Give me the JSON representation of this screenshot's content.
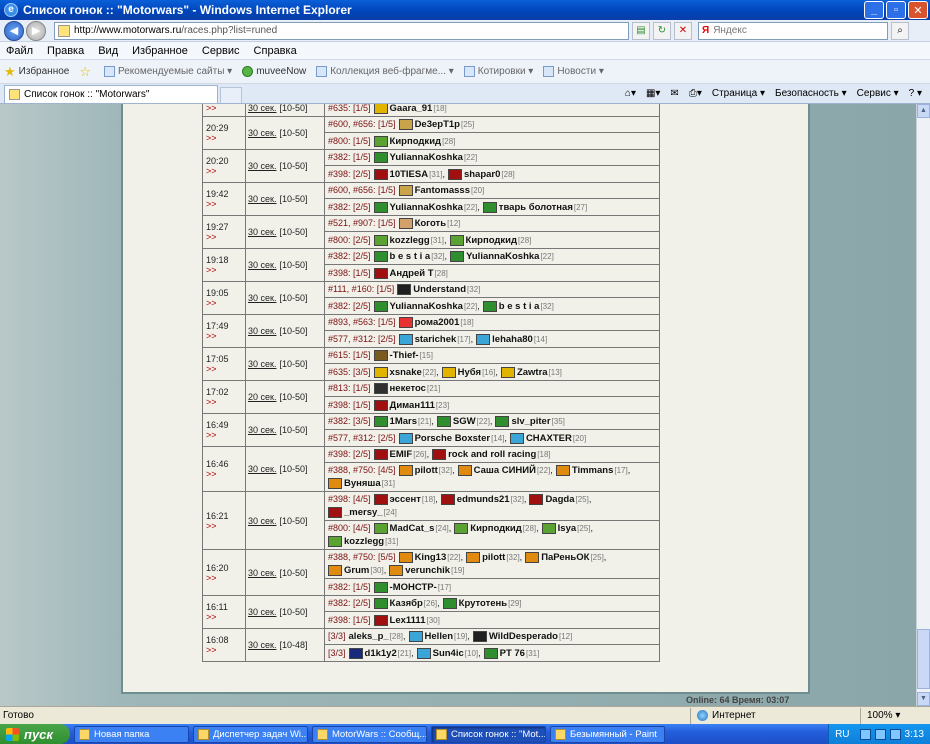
{
  "window": {
    "title": "Список гонок :: \"Motorwars\" - Windows Internet Explorer",
    "minimize": "_",
    "maximize": "▫",
    "close": "✕"
  },
  "address": {
    "url_host": "http://www.motorwars.ru",
    "url_path": "/races.php?list=runed",
    "search_label": "Я",
    "search_placeholder": "Яндекс"
  },
  "menu": [
    "Файл",
    "Правка",
    "Вид",
    "Избранное",
    "Сервис",
    "Справка"
  ],
  "favorites": {
    "label": "Избранное",
    "items": [
      "Рекомендуемые сайты ▾",
      "muveeNow",
      "Коллекция веб-фрагме... ▾",
      "Котировки ▾",
      "Новости ▾"
    ]
  },
  "tab": {
    "title": "Список гонок :: \"Motorwars\""
  },
  "tabtools": [
    "Страница ▾",
    "Безопасность ▾",
    "Сервис ▾",
    "? ▾"
  ],
  "races": [
    {
      "time": "",
      "duration": "30 сек.",
      "range": "[10-50]",
      "entries": [
        {
          "prefix": "#635: [1/5]",
          "racers": [
            {
              "name": "Gaara_91",
              "lvl": "[18]",
              "clan": "yb"
            }
          ]
        }
      ]
    },
    {
      "time": "20:29",
      "duration": "30 сек.",
      "range": "[10-50]",
      "entries": [
        {
          "prefix": "#600, #656: [1/5]",
          "racers": [
            {
              "name": "De3epT1p",
              "lvl": "[25]",
              "clan": "gold"
            }
          ]
        },
        {
          "prefix": "#800: [1/5]",
          "racers": [
            {
              "name": "Кирподкид",
              "lvl": "[28]",
              "clan": "leaf"
            }
          ]
        }
      ]
    },
    {
      "time": "20:20",
      "duration": "30 сек.",
      "range": "[10-50]",
      "entries": [
        {
          "prefix": "#382: [1/5]",
          "racers": [
            {
              "name": "YuliannaKoshka",
              "lvl": "[22]",
              "clan": "green"
            }
          ]
        },
        {
          "prefix": "#398: [2/5]",
          "racers": [
            {
              "name": "10TIESA",
              "lvl": "[31]",
              "clan": "red"
            },
            {
              "name": "shapar0",
              "lvl": "[28]",
              "clan": "red"
            }
          ]
        }
      ]
    },
    {
      "time": "19:42",
      "duration": "30 сек.",
      "range": "[10-50]",
      "entries": [
        {
          "prefix": "#600, #656: [1/5]",
          "racers": [
            {
              "name": "Fantomasss",
              "lvl": "[20]",
              "clan": "gold"
            }
          ]
        },
        {
          "prefix": "#382: [2/5]",
          "racers": [
            {
              "name": "YuliannaKoshka",
              "lvl": "[22]",
              "clan": "green"
            },
            {
              "name": "тварь болотная",
              "lvl": "[27]",
              "clan": "green"
            }
          ]
        }
      ]
    },
    {
      "time": "19:27",
      "duration": "30 сек.",
      "range": "[10-50]",
      "entries": [
        {
          "prefix": "#521, #907: [1/5]",
          "racers": [
            {
              "name": "Коготь",
              "lvl": "[12]",
              "clan": "face"
            }
          ]
        },
        {
          "prefix": "#800: [2/5]",
          "racers": [
            {
              "name": "kozzlegg",
              "lvl": "[31]",
              "clan": "leaf"
            },
            {
              "name": "Кирподкид",
              "lvl": "[28]",
              "clan": "leaf"
            }
          ]
        }
      ]
    },
    {
      "time": "19:18",
      "duration": "30 сек.",
      "range": "[10-50]",
      "entries": [
        {
          "prefix": "#382: [2/5]",
          "racers": [
            {
              "name": "b e s t i a",
              "lvl": "[32]",
              "clan": "green"
            },
            {
              "name": "YuliannaKoshka",
              "lvl": "[22]",
              "clan": "green"
            }
          ]
        },
        {
          "prefix": "#398: [1/5]",
          "racers": [
            {
              "name": "Андрей Т",
              "lvl": "[28]",
              "clan": "red"
            }
          ]
        }
      ]
    },
    {
      "time": "19:05",
      "duration": "30 сек.",
      "range": "[10-50]",
      "entries": [
        {
          "prefix": "#111, #160: [1/5]",
          "racers": [
            {
              "name": "Understand",
              "lvl": "[32]",
              "clan": "dark"
            }
          ]
        },
        {
          "prefix": "#382: [2/5]",
          "racers": [
            {
              "name": "YuliannaKoshka",
              "lvl": "[22]",
              "clan": "green"
            },
            {
              "name": "b e s t i a",
              "lvl": "[32]",
              "clan": "green"
            }
          ]
        }
      ]
    },
    {
      "time": "17:49",
      "duration": "30 сек.",
      "range": "[10-50]",
      "entries": [
        {
          "prefix": "#893, #563: [1/5]",
          "racers": [
            {
              "name": "рома2001",
              "lvl": "[18]",
              "clan": "bird"
            }
          ]
        },
        {
          "prefix": "#577, #312: [2/5]",
          "racers": [
            {
              "name": "starichek",
              "lvl": "[17]",
              "clan": "blue"
            },
            {
              "name": "lehaha80",
              "lvl": "[14]",
              "clan": "blue"
            }
          ]
        }
      ]
    },
    {
      "time": "17:05",
      "duration": "30 сек.",
      "range": "[10-50]",
      "entries": [
        {
          "prefix": "#615: [1/5]",
          "racers": [
            {
              "name": "-Thief-",
              "lvl": "[15]",
              "clan": "shield"
            }
          ]
        },
        {
          "prefix": "#635: [3/5]",
          "racers": [
            {
              "name": "xsnake",
              "lvl": "[22]",
              "clan": "yb"
            },
            {
              "name": "Нубя",
              "lvl": "[16]",
              "clan": "yb"
            },
            {
              "name": "Zawtra",
              "lvl": "[13]",
              "clan": "yb"
            }
          ]
        }
      ]
    },
    {
      "time": "17:02",
      "duration": "20 сек.",
      "range": "[10-50]",
      "entries": [
        {
          "prefix": "#813: [1/5]",
          "racers": [
            {
              "name": "некетос",
              "lvl": "[21]",
              "clan": "slash"
            }
          ]
        },
        {
          "prefix": "#398: [1/5]",
          "racers": [
            {
              "name": "Диман111",
              "lvl": "[23]",
              "clan": "red"
            }
          ]
        }
      ]
    },
    {
      "time": "16:49",
      "duration": "30 сек.",
      "range": "[10-50]",
      "entries": [
        {
          "prefix": "#382: [3/5]",
          "racers": [
            {
              "name": "1Mars",
              "lvl": "[21]",
              "clan": "green"
            },
            {
              "name": "SGW",
              "lvl": "[22]",
              "clan": "green"
            },
            {
              "name": "slv_piter",
              "lvl": "[35]",
              "clan": "green"
            }
          ]
        },
        {
          "prefix": "#577, #312: [2/5]",
          "racers": [
            {
              "name": "Porsche Boxster",
              "lvl": "[14]",
              "clan": "blue"
            },
            {
              "name": "CHAXTER",
              "lvl": "[20]",
              "clan": "blue"
            }
          ]
        }
      ]
    },
    {
      "time": "16:46",
      "duration": "30 сек.",
      "range": "[10-50]",
      "entries": [
        {
          "prefix": "#398: [2/5]",
          "racers": [
            {
              "name": "EMIF",
              "lvl": "[26]",
              "clan": "red"
            },
            {
              "name": "rock and roll racing",
              "lvl": "[18]",
              "clan": "red"
            }
          ]
        },
        {
          "prefix": "#388, #750: [4/5]",
          "racers": [
            {
              "name": "pilott",
              "lvl": "[32]",
              "clan": "orange"
            },
            {
              "name": "Саша СИНИЙ",
              "lvl": "[22]",
              "clan": "orange"
            },
            {
              "name": "Timmans",
              "lvl": "[17]",
              "clan": "orange"
            },
            {
              "name": "Вуняша",
              "lvl": "[31]",
              "clan": "orange"
            }
          ]
        }
      ]
    },
    {
      "time": "16:21",
      "duration": "30 сек.",
      "range": "[10-50]",
      "entries": [
        {
          "prefix": "#398: [4/5]",
          "racers": [
            {
              "name": "эссент",
              "lvl": "[18]",
              "clan": "red"
            },
            {
              "name": "edmunds21",
              "lvl": "[32]",
              "clan": "red"
            },
            {
              "name": "Dagda",
              "lvl": "[25]",
              "clan": "red"
            },
            {
              "name": "_mersy_",
              "lvl": "[24]",
              "clan": "red"
            }
          ]
        },
        {
          "prefix": "#800: [4/5]",
          "racers": [
            {
              "name": "MadCat_s",
              "lvl": "[24]",
              "clan": "leaf"
            },
            {
              "name": "Кирподкид",
              "lvl": "[28]",
              "clan": "leaf"
            },
            {
              "name": "Isya",
              "lvl": "[25]",
              "clan": "leaf"
            },
            {
              "name": "kozzlegg",
              "lvl": "[31]",
              "clan": "leaf"
            }
          ]
        }
      ]
    },
    {
      "time": "16:20",
      "duration": "30 сек.",
      "range": "[10-50]",
      "entries": [
        {
          "prefix": "#388, #750: [5/5]",
          "racers": [
            {
              "name": "King13",
              "lvl": "[22]",
              "clan": "orange"
            },
            {
              "name": "pilott",
              "lvl": "[32]",
              "clan": "orange"
            },
            {
              "name": "ПаРеньОК",
              "lvl": "[25]",
              "clan": "orange"
            },
            {
              "name": "Grum",
              "lvl": "[30]",
              "clan": "orange"
            },
            {
              "name": "verunchik",
              "lvl": "[19]",
              "clan": "orange"
            }
          ]
        },
        {
          "prefix": "#382: [1/5]",
          "racers": [
            {
              "name": "-МОНСТР-",
              "lvl": "[17]",
              "clan": "green"
            }
          ]
        }
      ]
    },
    {
      "time": "16:11",
      "duration": "30 сек.",
      "range": "[10-50]",
      "entries": [
        {
          "prefix": "#382: [2/5]",
          "racers": [
            {
              "name": "Казябр",
              "lvl": "[26]",
              "clan": "green"
            },
            {
              "name": "Крутотень",
              "lvl": "[29]",
              "clan": "green"
            }
          ]
        },
        {
          "prefix": "#398: [1/5]",
          "racers": [
            {
              "name": "Lex1111",
              "lvl": "[30]",
              "clan": "red"
            }
          ]
        }
      ]
    },
    {
      "time": "16:08",
      "duration": "30 сек.",
      "range": "[10-48]",
      "entries": [
        {
          "prefix": "[3/3]",
          "racers": [
            {
              "name": "aleks_p_",
              "lvl": "[28]",
              "clan": ""
            },
            {
              "name": "Hellen",
              "lvl": "[19]",
              "clan": "blue"
            },
            {
              "name": "WildDesperado",
              "lvl": "[12]",
              "clan": "dark"
            }
          ]
        },
        {
          "prefix": "[3/3]",
          "racers": [
            {
              "name": "d1k1y2",
              "lvl": "[21]",
              "clan": "navy"
            },
            {
              "name": "Sun4ic",
              "lvl": "[10]",
              "clan": "blue"
            },
            {
              "name": "PT 76",
              "lvl": "[31]",
              "clan": "green"
            }
          ]
        }
      ]
    }
  ],
  "arrow_label": ">>",
  "online": "Online: 64  Время: 03:07",
  "status": {
    "ready": "Готово",
    "zone": "Интернет",
    "zoom": "100% ▾"
  },
  "taskbar": {
    "start": "пуск",
    "items": [
      "Новая папка",
      "Диспетчер задач Wi...",
      "MotorWars :: Сообщ...",
      "Список гонок :: \"Mot...",
      "Безымянный - Paint"
    ],
    "lang": "RU",
    "clock": "3:13"
  },
  "clan_colors": {
    "red": "#a01010",
    "green": "#2f8f2f",
    "yb": "#e0b400",
    "gold": "#c9a44a",
    "leaf": "#5aa232",
    "blue": "#3aa6d8",
    "orange": "#e08a10",
    "dark": "#202020",
    "face": "#d3a06a",
    "bird": "#e83232",
    "shield": "#7a5a20",
    "slash": "#303030",
    "navy": "#1a2a7a"
  }
}
